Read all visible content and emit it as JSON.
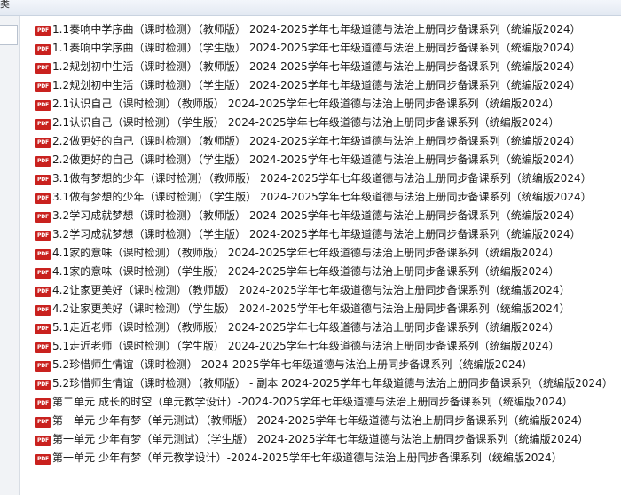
{
  "topbar": {
    "glyph": "类"
  },
  "icon_label": "PDF",
  "files": [
    {
      "icon": "pdf-icon",
      "name": "1.1奏响中学序曲（课时检测）（教师版） 2024-2025学年七年级道德与法治上册同步备课系列（统编版2024）"
    },
    {
      "icon": "pdf-icon",
      "name": "1.1奏响中学序曲（课时检测）（学生版） 2024-2025学年七年级道德与法治上册同步备课系列（统编版2024）"
    },
    {
      "icon": "pdf-icon",
      "name": "1.2规划初中生活（课时检测）（教师版） 2024-2025学年七年级道德与法治上册同步备课系列（统编版2024）"
    },
    {
      "icon": "pdf-icon",
      "name": "1.2规划初中生活（课时检测）（学生版） 2024-2025学年七年级道德与法治上册同步备课系列（统编版2024）"
    },
    {
      "icon": "pdf-icon",
      "name": "2.1认识自己（课时检测）（教师版） 2024-2025学年七年级道德与法治上册同步备课系列（统编版2024）"
    },
    {
      "icon": "pdf-icon",
      "name": "2.1认识自己（课时检测）（学生版） 2024-2025学年七年级道德与法治上册同步备课系列（统编版2024）"
    },
    {
      "icon": "pdf-icon",
      "name": "2.2做更好的自己（课时检测）（教师版） 2024-2025学年七年级道德与法治上册同步备课系列（统编版2024）"
    },
    {
      "icon": "pdf-icon",
      "name": "2.2做更好的自己（课时检测）（学生版） 2024-2025学年七年级道德与法治上册同步备课系列（统编版2024）"
    },
    {
      "icon": "pdf-icon",
      "name": "3.1做有梦想的少年（课时检测）（教师版） 2024-2025学年七年级道德与法治上册同步备课系列（统编版2024）"
    },
    {
      "icon": "pdf-icon",
      "name": "3.1做有梦想的少年（课时检测）（学生版） 2024-2025学年七年级道德与法治上册同步备课系列（统编版2024）"
    },
    {
      "icon": "pdf-icon",
      "name": "3.2学习成就梦想（课时检测）（教师版） 2024-2025学年七年级道德与法治上册同步备课系列（统编版2024）"
    },
    {
      "icon": "pdf-icon",
      "name": "3.2学习成就梦想（课时检测）（学生版） 2024-2025学年七年级道德与法治上册同步备课系列（统编版2024）"
    },
    {
      "icon": "pdf-icon",
      "name": "4.1家的意味（课时检测）（教师版） 2024-2025学年七年级道德与法治上册同步备课系列（统编版2024）"
    },
    {
      "icon": "pdf-icon",
      "name": "4.1家的意味（课时检测）（学生版） 2024-2025学年七年级道德与法治上册同步备课系列（统编版2024）"
    },
    {
      "icon": "pdf-icon",
      "name": "4.2让家更美好（课时检测）（教师版） 2024-2025学年七年级道德与法治上册同步备课系列（统编版2024）"
    },
    {
      "icon": "pdf-icon",
      "name": "4.2让家更美好（课时检测）（学生版） 2024-2025学年七年级道德与法治上册同步备课系列（统编版2024）"
    },
    {
      "icon": "pdf-icon",
      "name": "5.1走近老师（课时检测）（教师版） 2024-2025学年七年级道德与法治上册同步备课系列（统编版2024）"
    },
    {
      "icon": "pdf-icon",
      "name": "5.1走近老师（课时检测）（学生版） 2024-2025学年七年级道德与法治上册同步备课系列（统编版2024）"
    },
    {
      "icon": "pdf-icon",
      "name": "5.2珍惜师生情谊（课时检测） 2024-2025学年七年级道德与法治上册同步备课系列（统编版2024）"
    },
    {
      "icon": "pdf-icon",
      "name": "5.2珍惜师生情谊（课时检测）（教师版） - 副本 2024-2025学年七年级道德与法治上册同步备课系列（统编版2024）"
    },
    {
      "icon": "pdf-icon",
      "name": "第二单元 成长的时空（单元教学设计）-2024-2025学年七年级道德与法治上册同步备课系列（统编版2024）"
    },
    {
      "icon": "pdf-icon",
      "name": "第一单元 少年有梦（单元测试）（教师版） 2024-2025学年七年级道德与法治上册同步备课系列（统编版2024）"
    },
    {
      "icon": "pdf-icon",
      "name": "第一单元 少年有梦（单元测试）（学生版） 2024-2025学年七年级道德与法治上册同步备课系列（统编版2024）"
    },
    {
      "icon": "pdf-icon",
      "name": "第一单元 少年有梦（单元教学设计）-2024-2025学年七年级道德与法治上册同步备课系列（统编版2024）"
    }
  ]
}
